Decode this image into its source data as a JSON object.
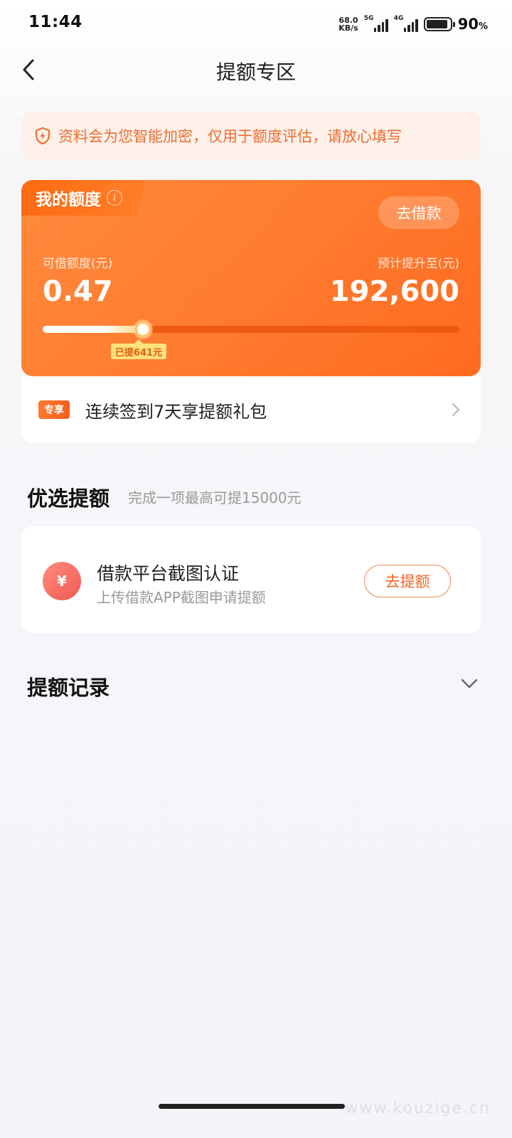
{
  "status_bar": {
    "time": "11:44",
    "net_speed_value": "68.0",
    "net_speed_unit": "KB/s",
    "signal_1_label": "5G",
    "signal_2_label": "4G",
    "battery_percent": "90",
    "battery_unit": "%",
    "battery_level": 0.9
  },
  "header": {
    "title": "提额专区",
    "back_icon": "chevron-left-icon"
  },
  "notice": {
    "icon": "shield-bolt-icon",
    "text": "资料会为您智能加密，仅用于额度评估，请放心填写"
  },
  "quota_card": {
    "tag_label": "我的额度",
    "info_icon": "i",
    "borrow_button": "去借款",
    "available_label": "可借额度(元)",
    "available_value": "0.47",
    "forecast_label": "预计提升至(元)",
    "forecast_value": "192,600",
    "progress_fraction": 0.24,
    "raised_badge": "已提641元",
    "colors": {
      "primary": "#ff7a2e",
      "track": "#ee5a12",
      "badge": "#ffe27c"
    }
  },
  "signin": {
    "badge": "专享",
    "text": "连续签到7天享提额礼包"
  },
  "preferred": {
    "title": "优选提额",
    "subtitle": "完成一项最高可提15000元",
    "task": {
      "icon": "yuan-icon",
      "icon_glyph": "¥",
      "title": "借款平台截图认证",
      "desc": "上传借款APP截图申请提额",
      "button": "去提额"
    }
  },
  "records": {
    "title": "提额记录"
  },
  "watermark": "www.kouzige.cn"
}
